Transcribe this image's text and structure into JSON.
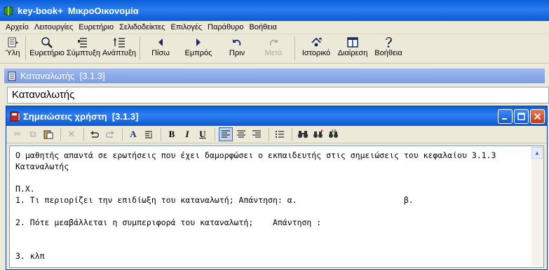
{
  "window": {
    "title": "key-book+  ΜικροΟικονομία"
  },
  "menu": [
    "Αρχείο",
    "Λειτουργίες",
    "Ευρετήριο",
    "Σελιδοδείκτες",
    "Επιλογές",
    "Παράθυρο",
    "Βοήθεια"
  ],
  "toolbar": {
    "yli": "Ύλη",
    "eyretirio": "Ευρετήριο",
    "symptyxi": "Σύμπτυξη",
    "anaptyxi": "Ανάπτυξη",
    "piso": "Πίσω",
    "empros": "Εμπρός",
    "prin": "Πριν",
    "meta": "Μετά",
    "istoriko": "Ιστορικό",
    "diairesi": "Διαίρεση",
    "voitheia": "Βοήθεια"
  },
  "document": {
    "header": "Καταναλωτής  [3.1.3]",
    "content_title": "Καταναλωτής"
  },
  "notes_window": {
    "title": "Σημειώσεις χρήστη  [3.1.3]",
    "lines": [
      "Ο μαθητής απαντά σε ερωτήσεις που έχει δαμορφώσει ο εκπαιδευτής στις σημειώσεις του κεφαλαίου 3.1.3",
      "Καταναλωτής",
      "",
      "Π.Χ.",
      "1. Τι περιορίζει την επιδίωξη του καταναλωτή; Απάντηση: α.                      β.",
      "",
      "2. Πότε μεαβάλλεται η συμπεριφορά του καταναλωτή;    Απάντηση :",
      "",
      "",
      "3. κλπ"
    ]
  },
  "colors": {
    "title_blue": "#0a5fd8",
    "doc_header": "#7d9ee4",
    "close_red": "#c43a16"
  }
}
